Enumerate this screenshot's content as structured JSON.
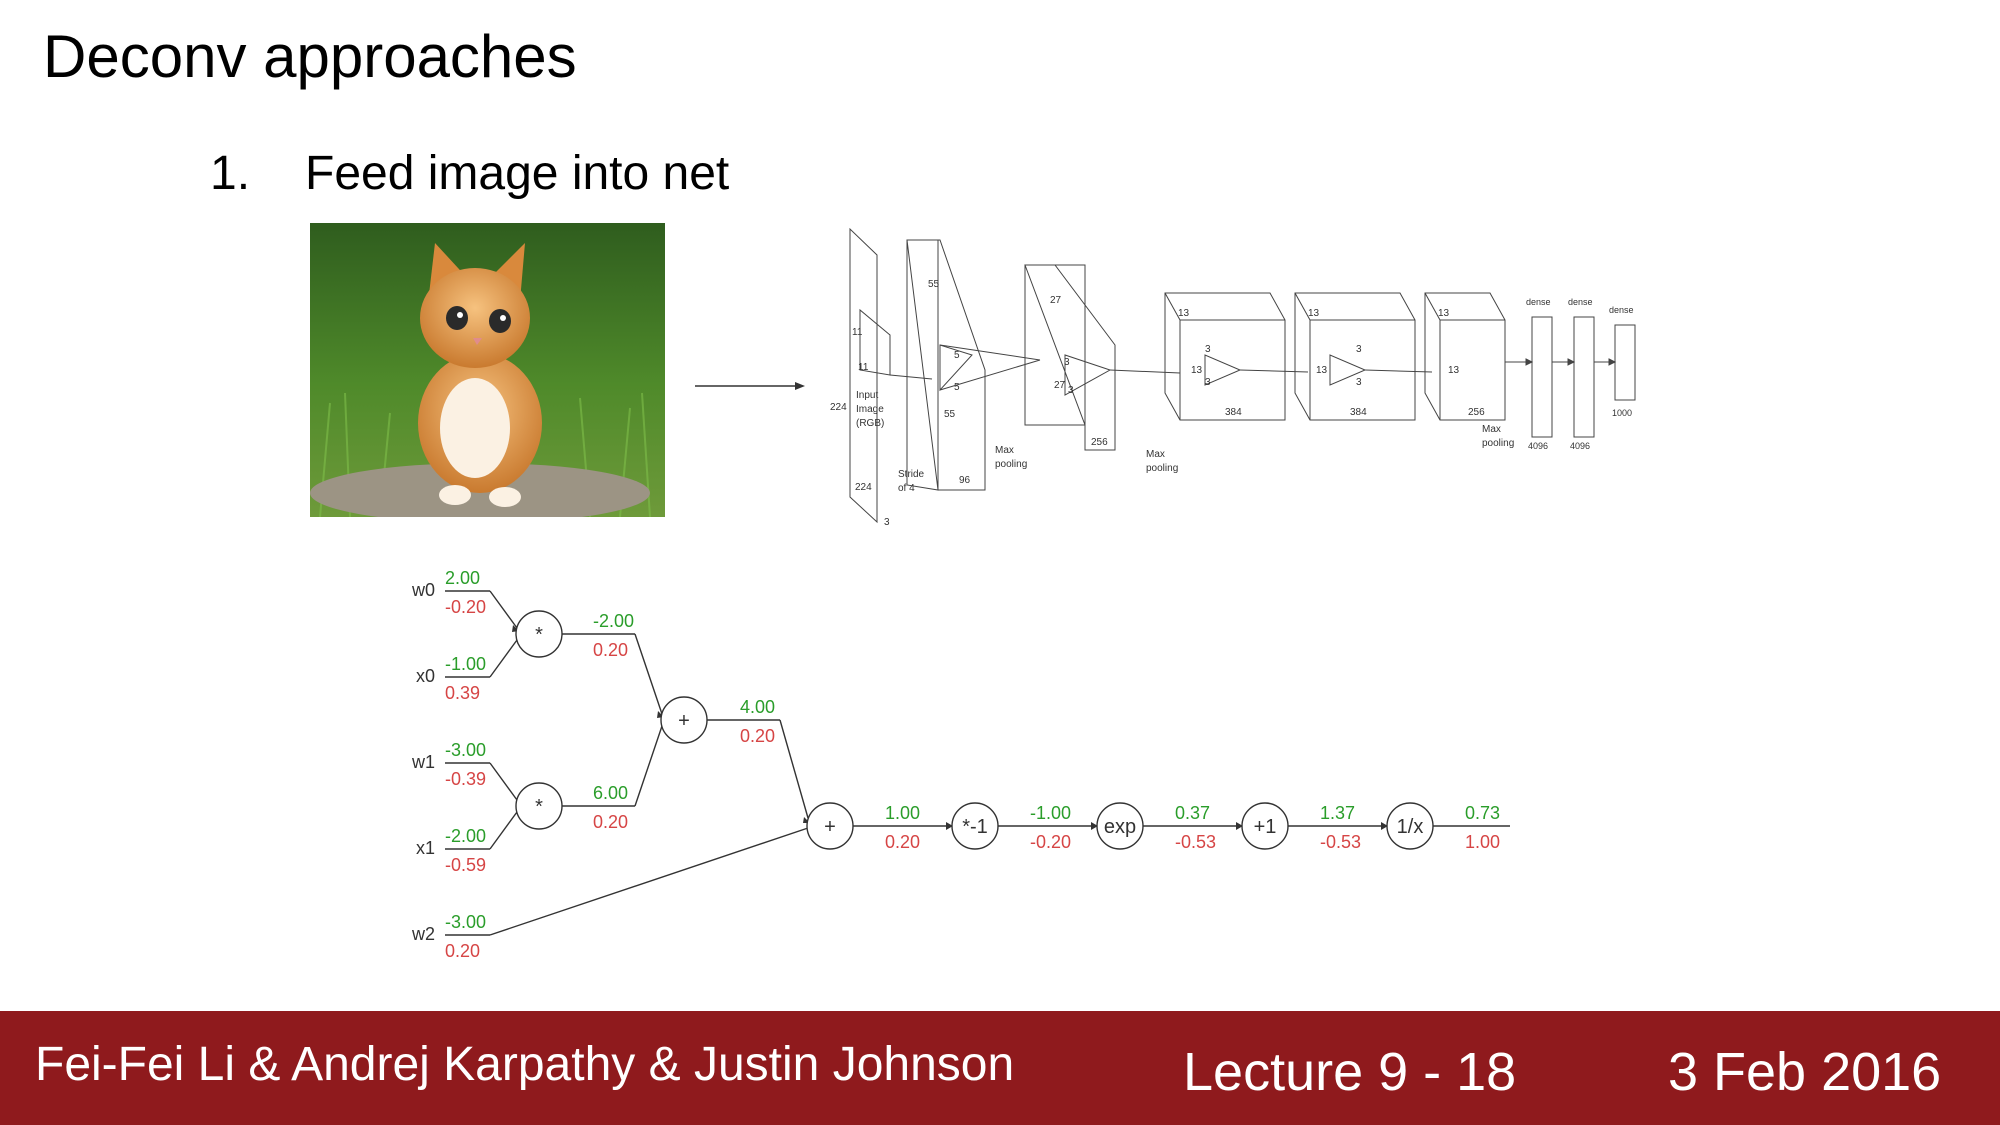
{
  "slide": {
    "title": "Deconv approaches",
    "bullet_number": "1.",
    "bullet_text": "Feed image into net"
  },
  "net": {
    "input": {
      "n11a": "11",
      "n11b": "11",
      "n224a": "224",
      "n224b": "224",
      "n3": "3",
      "label1": "Input",
      "label2": "Image",
      "label3": "(RGB)",
      "stride1": "Stride",
      "stride2": "of 4"
    },
    "conv1": {
      "n55a": "55",
      "n55b": "55",
      "n5a": "5",
      "n5b": "5",
      "n96": "96",
      "pool1": "Max",
      "pool2": "pooling"
    },
    "conv2": {
      "n27a": "27",
      "n27b": "27",
      "n3a": "3",
      "n3b": "3",
      "n256": "256",
      "pool1": "Max",
      "pool2": "pooling"
    },
    "conv3": {
      "n13a": "13",
      "n13b": "13",
      "n3a": "3",
      "n3b": "3",
      "n384": "384"
    },
    "conv4": {
      "n13a": "13",
      "n13b": "13",
      "n3a": "3",
      "n3b": "3",
      "n384": "384"
    },
    "conv5": {
      "n13a": "13",
      "n13b": "13",
      "n256": "256",
      "pool1": "Max",
      "pool2": "pooling"
    },
    "dense": {
      "label": "dense",
      "n4096a": "4096",
      "n4096b": "4096",
      "n1000": "1000"
    }
  },
  "graph": {
    "inputs": [
      {
        "name": "w0",
        "fwd": "2.00",
        "grad": "-0.20"
      },
      {
        "name": "x0",
        "fwd": "-1.00",
        "grad": "0.39"
      },
      {
        "name": "w1",
        "fwd": "-3.00",
        "grad": "-0.39"
      },
      {
        "name": "x1",
        "fwd": "-2.00",
        "grad": "-0.59"
      },
      {
        "name": "w2",
        "fwd": "-3.00",
        "grad": "0.20"
      }
    ],
    "mul0": {
      "op": "*",
      "fwd": "-2.00",
      "grad": "0.20"
    },
    "mul1": {
      "op": "*",
      "fwd": "6.00",
      "grad": "0.20"
    },
    "add0": {
      "op": "+",
      "fwd": "4.00",
      "grad": "0.20"
    },
    "chain": [
      {
        "op": "+",
        "fwd": "1.00",
        "grad": "0.20"
      },
      {
        "op": "*-1",
        "fwd": "-1.00",
        "grad": "-0.20"
      },
      {
        "op": "exp",
        "fwd": "0.37",
        "grad": "-0.53"
      },
      {
        "op": "+1",
        "fwd": "1.37",
        "grad": "-0.53"
      },
      {
        "op": "1/x",
        "fwd": "0.73",
        "grad": "1.00"
      }
    ],
    "colors": {
      "forward": "#2a9d2a",
      "gradient": "#d64545"
    }
  },
  "footer": {
    "authors": "Fei-Fei Li & Andrej Karpathy & Justin Johnson",
    "lecture": "Lecture 9 - 18",
    "date": "3 Feb 2016"
  },
  "colors": {
    "footer_bg": "#8f1a1d"
  }
}
